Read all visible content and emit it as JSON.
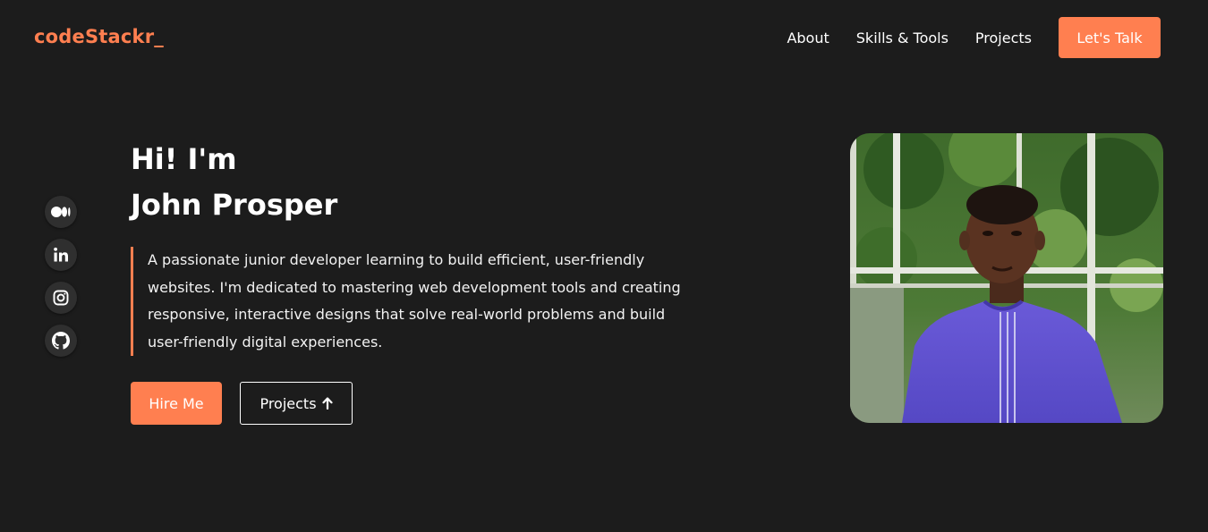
{
  "header": {
    "logo": "codeStackr_",
    "nav": [
      {
        "label": "About"
      },
      {
        "label": "Skills & Tools"
      },
      {
        "label": "Projects"
      }
    ],
    "cta_label": "Let's Talk"
  },
  "socials": [
    {
      "icon": "medium-icon"
    },
    {
      "icon": "linkedin-icon"
    },
    {
      "icon": "instagram-icon"
    },
    {
      "icon": "github-icon"
    }
  ],
  "hero": {
    "greeting": "Hi! I'm",
    "name": "John Prosper",
    "intro": "A passionate junior developer learning to build efficient, user-friendly websites. I'm dedicated to mastering web development tools and creating responsive, interactive designs that solve real-world problems and build user-friendly digital experiences.",
    "hire_label": "Hire Me",
    "projects_label": "Projects"
  },
  "colors": {
    "accent": "#ff7f50",
    "background": "#1c1c1c",
    "icon_bg": "#2f2f2f"
  }
}
